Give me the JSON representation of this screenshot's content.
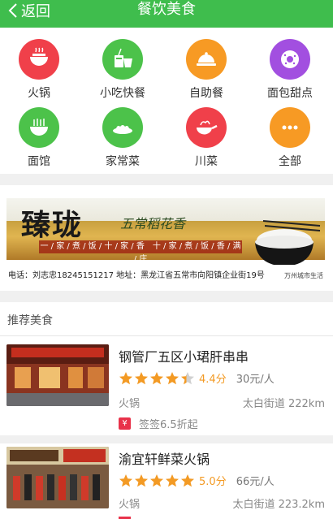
{
  "header": {
    "back_label": "返回",
    "title": "餐饮美食",
    "bg": "#3fbd4d"
  },
  "categories": [
    {
      "label": "火锅",
      "icon": "hotpot-icon",
      "color": "#f0404a"
    },
    {
      "label": "小吃快餐",
      "icon": "fastfood-icon",
      "color": "#4cc24a"
    },
    {
      "label": "自助餐",
      "icon": "buffet-icon",
      "color": "#f79a24"
    },
    {
      "label": "面包甜点",
      "icon": "donut-icon",
      "color": "#a24fe0"
    },
    {
      "label": "面馆",
      "icon": "noodle-icon",
      "color": "#4cc24a"
    },
    {
      "label": "家常菜",
      "icon": "home-dish-icon",
      "color": "#4cc24a"
    },
    {
      "label": "川菜",
      "icon": "sichuan-wok-icon",
      "color": "#f0404a"
    },
    {
      "label": "全部",
      "icon": "more-icon",
      "color": "#f79a24"
    }
  ],
  "banner": {
    "brand": "臻珑",
    "slogan": "五常稻花香",
    "strip": "一 / 家 / 煮 / 饭 / 十 / 家 / 香　十 / 家 / 煮 / 饭 / 香 / 满 / 庄",
    "contact": "电话：刘志忠18245151217  地址：黑龙江省五常市向阳镇企业街19号",
    "watermark": "万州城市生活"
  },
  "section": {
    "title": "推荐美食"
  },
  "shops": [
    {
      "name": "钢管厂五区小珺肝串串",
      "rating": 4.4,
      "score_text": "4.4分",
      "price": "30元/人",
      "cuisine": "火锅",
      "location": "太白街道 222km",
      "promo_badge": "¥",
      "promo": "签签6.5折起"
    },
    {
      "name": "渝宜轩鲜菜火锅",
      "rating": 5.0,
      "score_text": "5.0分",
      "price": "66元/人",
      "cuisine": "火锅",
      "location": "太白街道 223.2km",
      "promo_badge": "",
      "promo": ""
    }
  ],
  "colors": {
    "star": "#f39a24",
    "star_empty": "#d0d0d0",
    "promo": "#e8324a"
  }
}
